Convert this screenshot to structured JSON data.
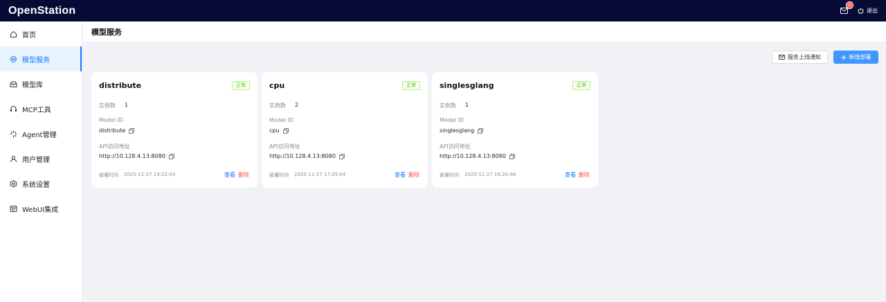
{
  "header": {
    "app_title": "OpenStation",
    "notification_count": "0",
    "logout_label": "退出"
  },
  "sidebar": {
    "items": [
      {
        "label": "首页",
        "icon": "home-icon"
      },
      {
        "label": "模型服务",
        "icon": "model-service-icon",
        "active": true
      },
      {
        "label": "模型库",
        "icon": "model-library-icon"
      },
      {
        "label": "MCP工具",
        "icon": "mcp-tools-icon"
      },
      {
        "label": "Agent管理",
        "icon": "agent-icon"
      },
      {
        "label": "用户管理",
        "icon": "user-icon"
      },
      {
        "label": "系统设置",
        "icon": "settings-icon"
      },
      {
        "label": "WebUI集成",
        "icon": "webui-icon"
      }
    ]
  },
  "page": {
    "title": "模型服务",
    "notify_button_label": "服务上线通知",
    "add_button_label": "新增部署"
  },
  "labels": {
    "instances": "实例数",
    "model_id": "Model ID",
    "api_address": "API访问地址",
    "deploy_time": "部署时间",
    "view": "查看",
    "delete": "删除"
  },
  "cards": [
    {
      "name": "distribute",
      "status": "正常",
      "instances": "1",
      "model_id": "distribute",
      "api_address": "http://10.128.4.13:8080",
      "deploy_time": "2025-11-27 19:22:54"
    },
    {
      "name": "cpu",
      "status": "正常",
      "instances": "2",
      "model_id": "cpu",
      "api_address": "http://10.128.4.13:8080",
      "deploy_time": "2025-11-27 17:25:04"
    },
    {
      "name": "singlesglang",
      "status": "正常",
      "instances": "1",
      "model_id": "singlesglang",
      "api_address": "http://10.128.4.13:8080",
      "deploy_time": "2025-11-27 19:20:46"
    }
  ],
  "colors": {
    "header_bg": "#050b35",
    "primary": "#1677ff",
    "danger": "#ff4d4f",
    "success": "#52c41a"
  }
}
